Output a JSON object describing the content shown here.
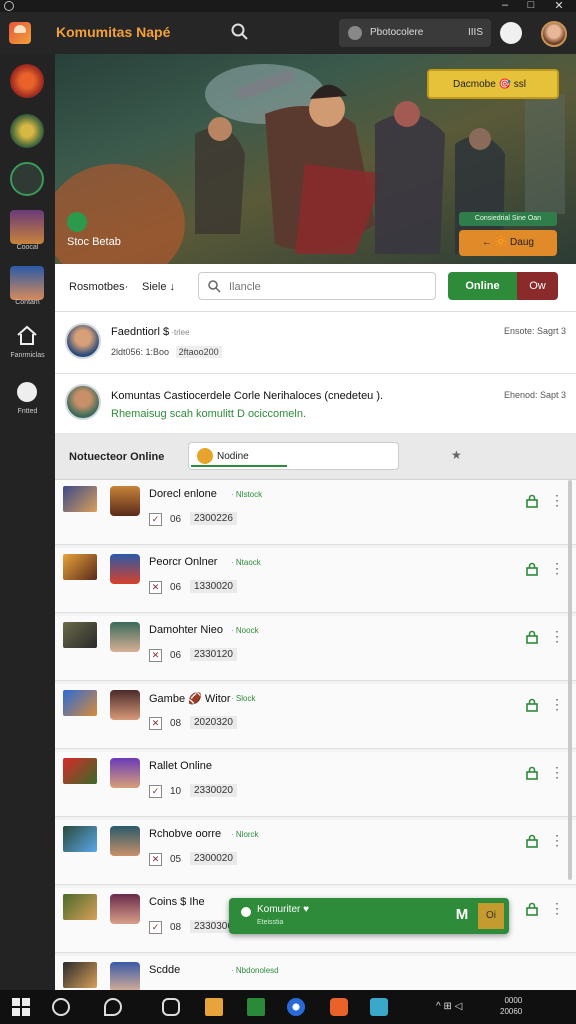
{
  "app": {
    "title": "Komumitas Napé"
  },
  "header": {
    "account_label": "Pbotocolere",
    "account_number": "IIIS"
  },
  "sidebar": {
    "items": [
      {
        "icon": "game-logo-icon",
        "label": ""
      },
      {
        "icon": "hero-class-icon",
        "label": ""
      },
      {
        "icon": "refresh-icon",
        "label": ""
      },
      {
        "icon": "warrior-avatar",
        "label": "Coocal"
      },
      {
        "icon": "mage-avatar",
        "label": "Contam"
      },
      {
        "icon": "home-icon",
        "label": "Fanrmiclas"
      },
      {
        "icon": "help-icon",
        "label": "Fntted"
      }
    ]
  },
  "hero": {
    "badge": "Dacmobe 🎯 ssl",
    "online": "Consiedrial Sine Oan",
    "button": "← 🔆 Daug",
    "tag": "Stoc Betab"
  },
  "tabs": {
    "tab1": "Rosmotbes·",
    "tab2": "Siele ↓",
    "search_placeholder": "Ilancle",
    "online": "Online",
    "other": "Ow"
  },
  "feed": [
    {
      "title": "Faedntiorl $",
      "title_suffix": " ·trlee",
      "meta": "2ldt056: 1:Boo",
      "meta2": "2ftaoo200",
      "time": "Ensote: Sagrt 3"
    },
    {
      "title": "Komuntas Castiocerdele Corle Nerihaloces (cnedeteu ).",
      "sub": "Rhemaisug scah komulitt D ociccomeln.",
      "time": "Ehenod: Sapt 3"
    }
  ],
  "list": {
    "header": "Notuecteor Online",
    "filter": "Nodine",
    "rows": [
      {
        "name": "Dorecl enlone",
        "status": "Nlstock",
        "level": "06",
        "id": "2300226",
        "checked": false
      },
      {
        "name": "Peorcr Onlner",
        "status": "Ntaock",
        "level": "06",
        "id": "1330020",
        "checked": true
      },
      {
        "name": "Damohter Nieo",
        "status": "Noock",
        "level": "06",
        "id": "2330120",
        "checked": true
      },
      {
        "name": "Gambe 🏈 Witor",
        "status": "Slock",
        "level": "08",
        "id": "2020320",
        "checked": true
      },
      {
        "name": "Rallet Online",
        "status": "",
        "level": "10",
        "id": "2330020",
        "checked": false
      },
      {
        "name": "Rchobve oorre",
        "status": "Nlorck",
        "level": "05",
        "id": "2300020",
        "checked": true
      },
      {
        "name": "Coins $ Ihe",
        "status": "",
        "level": "08",
        "id": "2330306",
        "checked": false
      },
      {
        "name": "Scdde",
        "status": "Nbdonolesd",
        "level": "",
        "id": "",
        "checked": false
      }
    ]
  },
  "chat": {
    "title": "Komuriter ♥",
    "subtitle": "Eteisstia",
    "m_label": "M",
    "o_label": "Oi"
  },
  "taskbar": {
    "tray": "^ ⊞ ◁",
    "time": "0000",
    "date": "20060"
  },
  "colors": {
    "accent_orange": "#f3a03b",
    "online_green": "#2e8b3a",
    "offline_red": "#8b2a2a",
    "badge_yellow": "#e6c23a"
  }
}
